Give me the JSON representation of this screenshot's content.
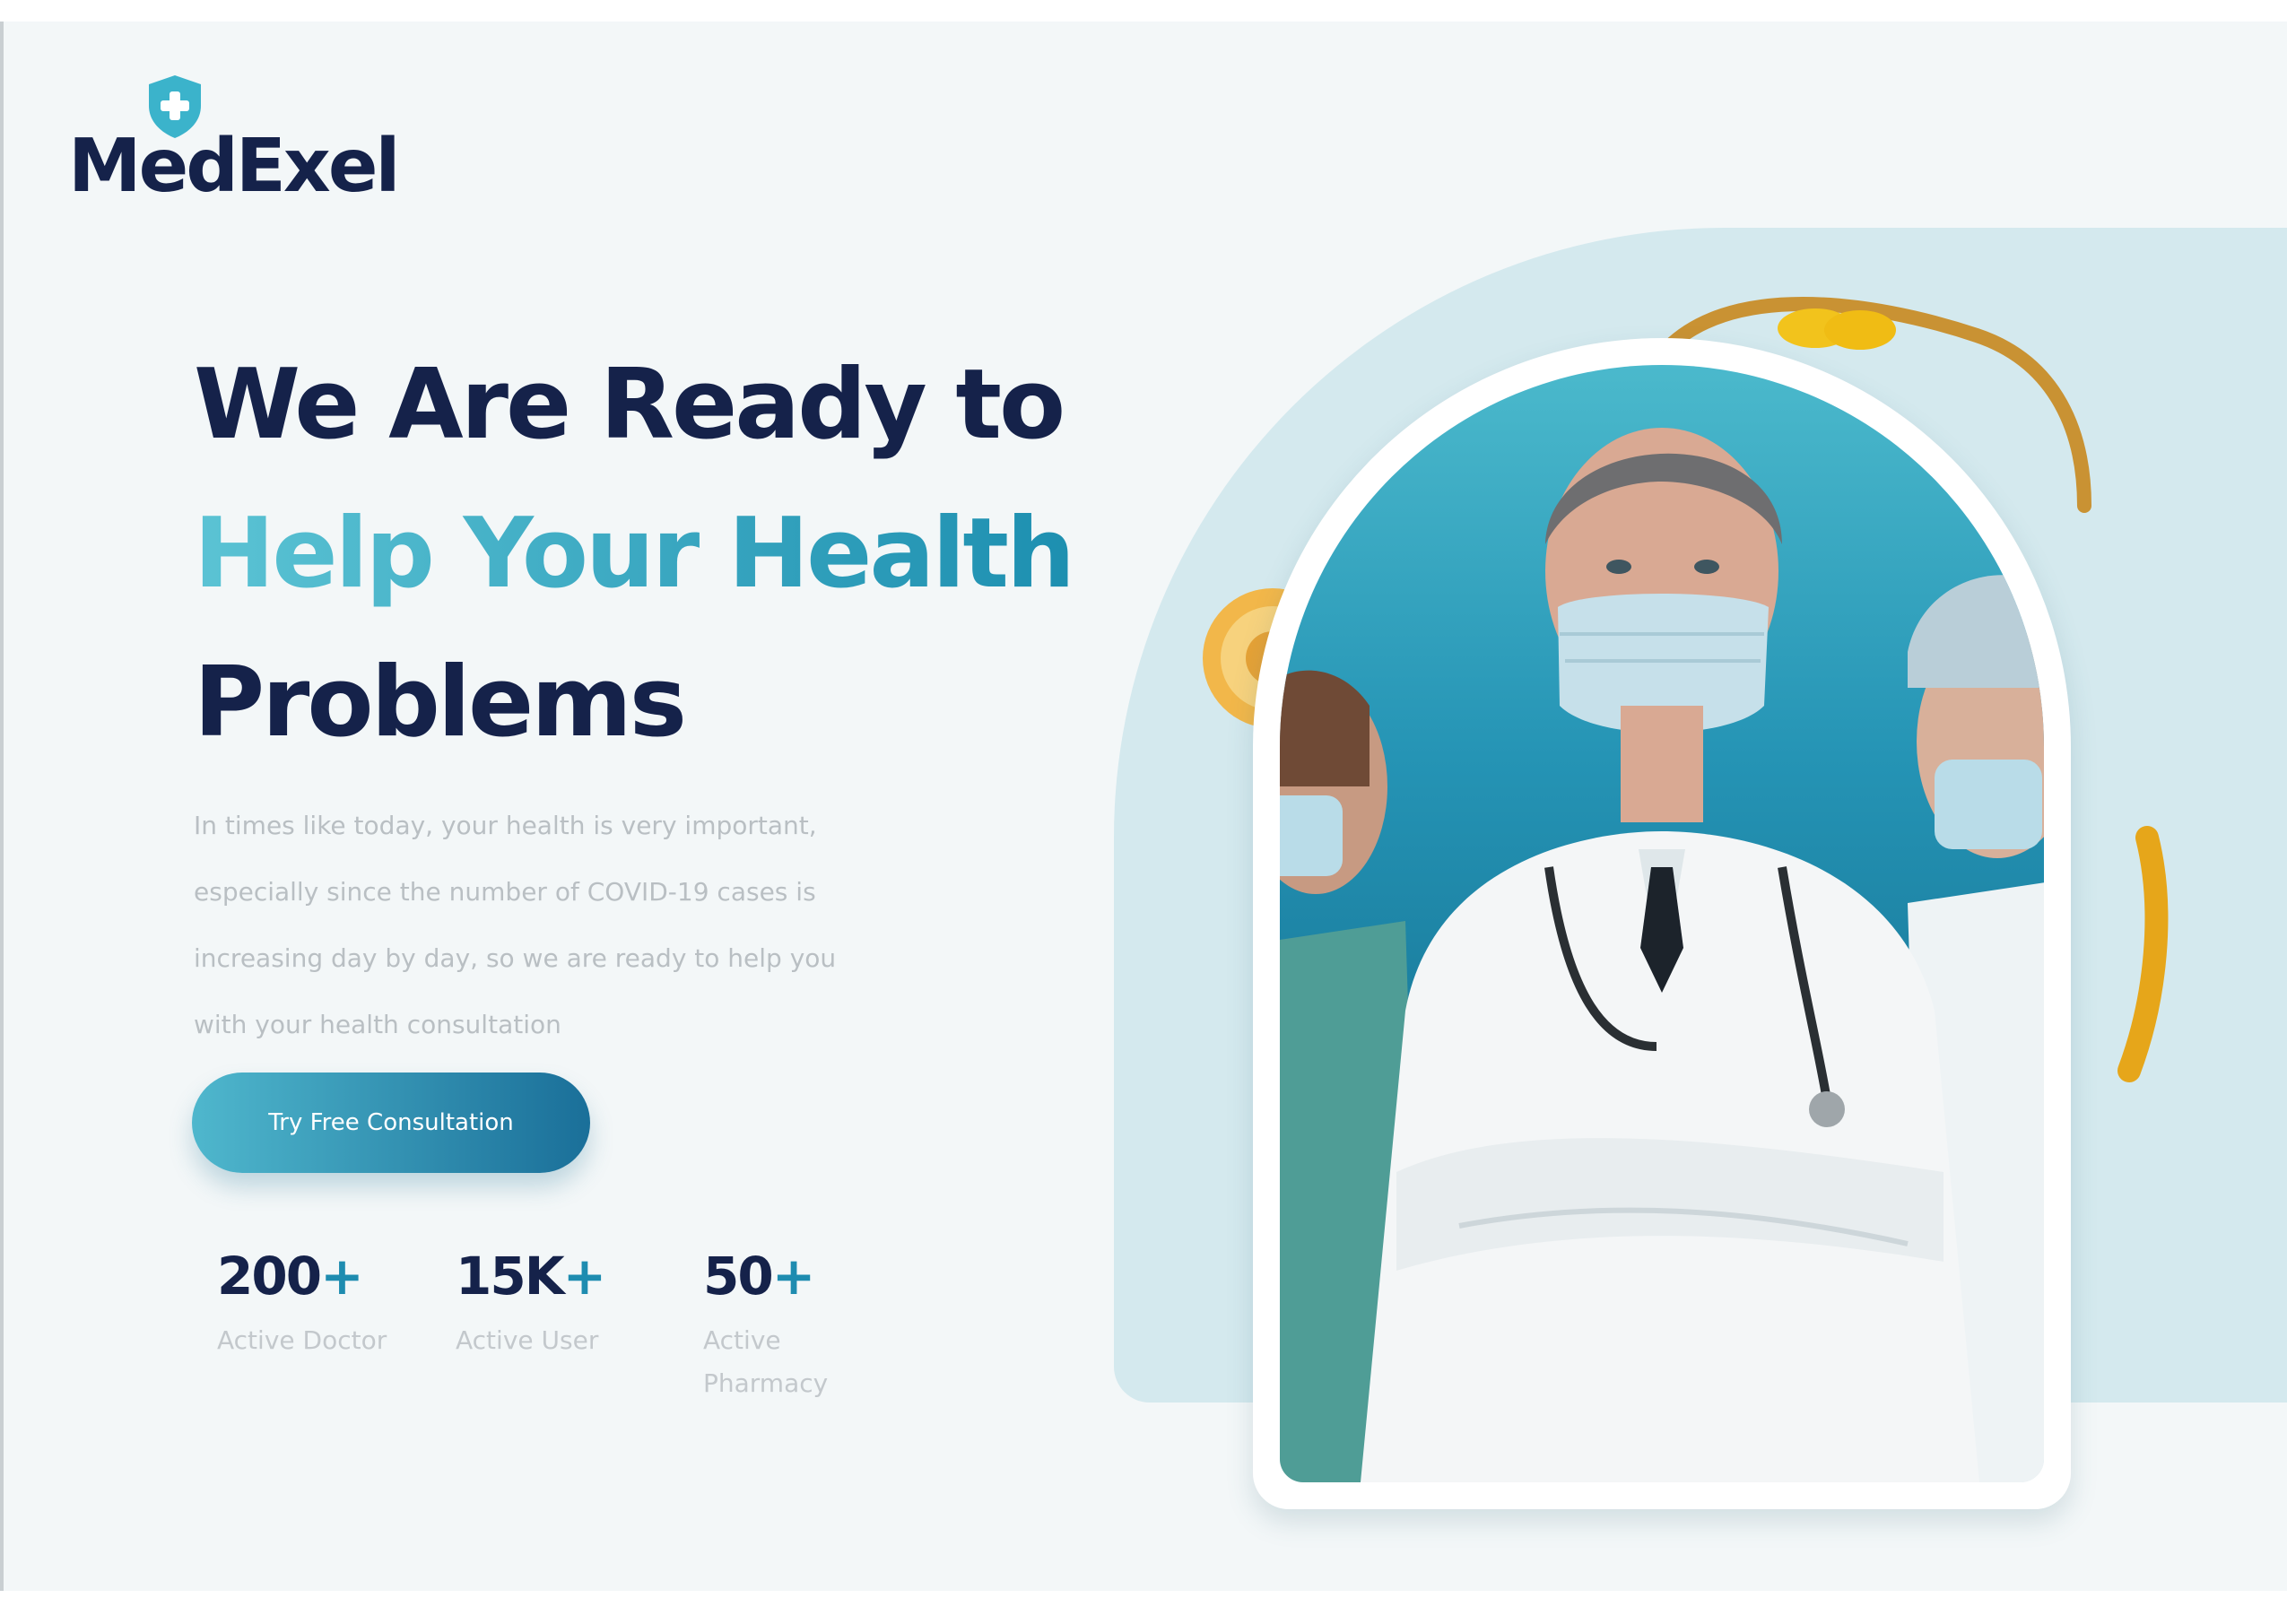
{
  "brand": {
    "name": "MedExel",
    "logo_icon": "shield-plus-icon",
    "colors": {
      "navy": "#15224a",
      "teal": "#3bb0c9",
      "teal_dark": "#1a6f99"
    }
  },
  "hero": {
    "headline": {
      "line1": "We Are Ready to",
      "line2": "Help Your Health",
      "line3": "Problems"
    },
    "description": [
      "In times like today, your health is very important,",
      "especially since the number of COVID-19 cases is",
      "increasing day by day, so we are ready to help you",
      "with your health consultation"
    ],
    "cta_label": "Try Free Consultation",
    "image_subject": "doctor-with-medical-staff-image"
  },
  "stats": [
    {
      "value": "200",
      "suffix": "+",
      "label": "Active Doctor"
    },
    {
      "value": "15K",
      "suffix": "+",
      "label": "Active User"
    },
    {
      "value": "50",
      "suffix": "+",
      "label": "Active Pharmacy"
    }
  ]
}
